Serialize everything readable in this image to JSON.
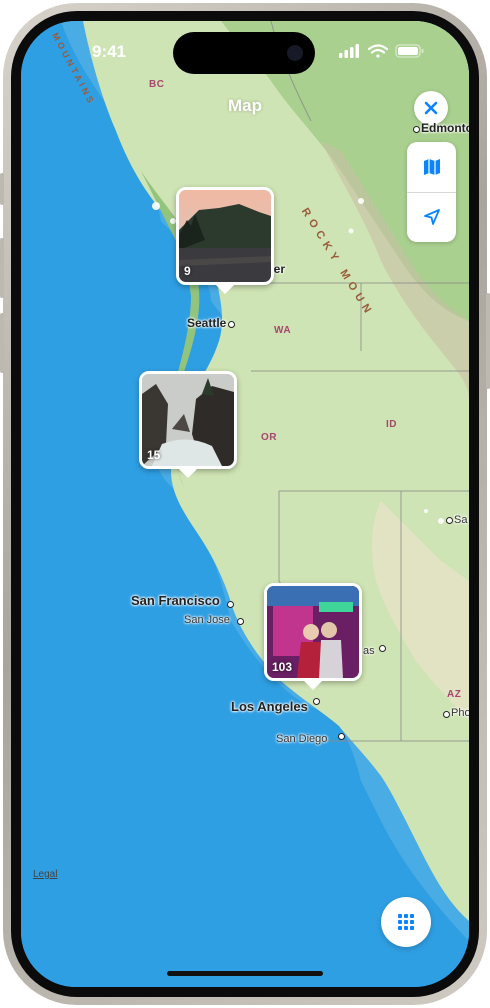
{
  "status_bar": {
    "time": "9:41"
  },
  "header": {
    "title": "Map"
  },
  "controls": {
    "close_icon": "close-icon",
    "map_icon": "map-icon",
    "location_icon": "location-arrow-icon",
    "grid_icon": "grid-icon"
  },
  "pins": [
    {
      "count": "9",
      "scene": "lake-trees"
    },
    {
      "count": "15",
      "scene": "rocky-coast"
    },
    {
      "count": "103",
      "scene": "neon-people"
    }
  ],
  "map_labels": {
    "cities": {
      "edmonton": "Edmonto",
      "vancouver": "ver",
      "seattle": "Seattle",
      "san_francisco": "San Francisco",
      "san_jose": "San Jose",
      "las_vegas": "as",
      "los_angeles": "Los Angeles",
      "san_diego": "San Diego",
      "salt_lake": "Sa",
      "phoenix": "Pho"
    },
    "states": {
      "bc": "BC",
      "wa": "WA",
      "or": "OR",
      "id": "ID",
      "az": "AZ"
    },
    "regions": {
      "rocky": "ROCKY MOUN",
      "coast_mountains": "MOUNTAINS"
    }
  },
  "footer": {
    "legal": "Legal"
  },
  "colors": {
    "ocean": "#2f9fe3",
    "land": "#cfe4b4",
    "forest": "#a9d08f",
    "accent": "#0a84ff"
  }
}
